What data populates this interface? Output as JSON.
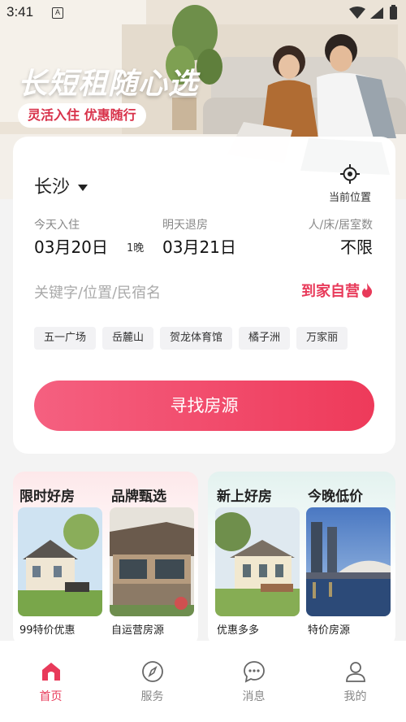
{
  "status_bar": {
    "time": "3:41",
    "notification_letter": "A"
  },
  "hero": {
    "title": "长短租随心选",
    "subtitle": "灵活入住 优惠随行"
  },
  "search": {
    "city": "长沙",
    "location_label": "当前位置",
    "checkin_label": "今天入住",
    "checkin_date": "03月20日",
    "nights": "1晚",
    "checkout_label": "明天退房",
    "checkout_date": "03月21日",
    "guests_label": "人/床/居室数",
    "guests_value": "不限",
    "keyword_placeholder": "关键字/位置/民宿名",
    "self_operated": "到家自营",
    "tags": [
      "五一广场",
      "岳麓山",
      "贺龙体育馆",
      "橘子洲",
      "万家丽"
    ],
    "button_label": "寻找房源"
  },
  "features": [
    {
      "title": "限时好房",
      "caption": "99特价优惠"
    },
    {
      "title": "品牌甄选",
      "caption": "自运营房源"
    },
    {
      "title": "新上好房",
      "caption": "优惠多多"
    },
    {
      "title": "今晚低价",
      "caption": "特价房源"
    }
  ],
  "tabs": [
    {
      "label": "首页",
      "icon": "home-icon",
      "active": true
    },
    {
      "label": "服务",
      "icon": "compass-icon",
      "active": false
    },
    {
      "label": "消息",
      "icon": "chat-icon",
      "active": false
    },
    {
      "label": "我的",
      "icon": "profile-icon",
      "active": false
    }
  ],
  "colors": {
    "accent": "#e83a5a",
    "brand_pink": "#f56080"
  }
}
